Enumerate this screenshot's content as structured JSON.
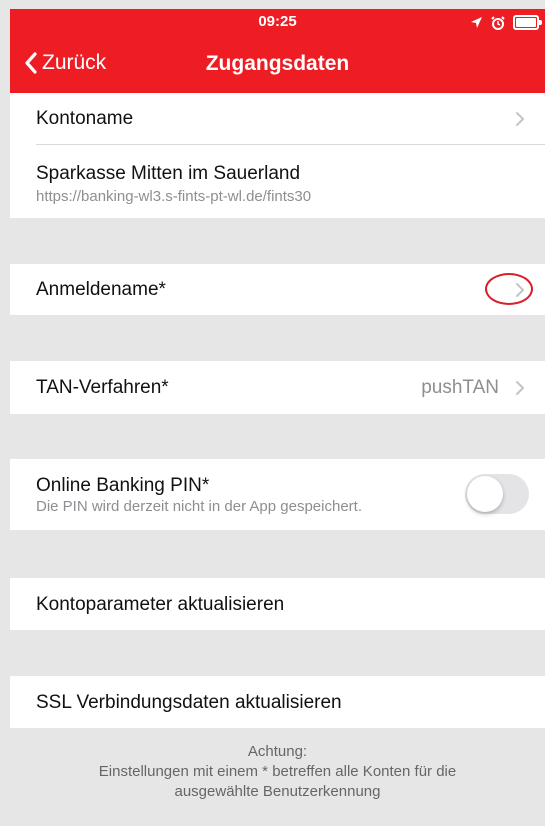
{
  "status": {
    "time": "09:25"
  },
  "nav": {
    "back_label": "Zurück",
    "title": "Zugangsdaten"
  },
  "rows": {
    "kontoname": "Kontoname",
    "bank_name": "Sparkasse Mitten im Sauerland",
    "bank_url": "https://banking-wl3.s-fints-pt-wl.de/fints30",
    "anmeldename": "Anmeldename*",
    "tan_label": "TAN-Verfahren*",
    "tan_value": "pushTAN",
    "pin_label": "Online Banking PIN*",
    "pin_sub": "Die PIN wird derzeit nicht in der App gespeichert.",
    "pin_saved": false,
    "kontoparameter": "Kontoparameter aktualisieren",
    "ssl": "SSL Verbindungsdaten aktualisieren"
  },
  "footer": {
    "line1": "Achtung:",
    "line2": "Einstellungen mit einem * betreffen alle Konten für die",
    "line3": "ausgewählte Benutzerkennung"
  },
  "icons": {
    "back": "chevron-left-icon",
    "disclosure": "chevron-right-icon",
    "location": "location-arrow-icon",
    "alarm": "alarm-clock-icon",
    "battery": "battery-icon"
  },
  "colors": {
    "brand": "#ee1c23",
    "background": "#e6e6e6",
    "annotation": "#d8202b"
  }
}
